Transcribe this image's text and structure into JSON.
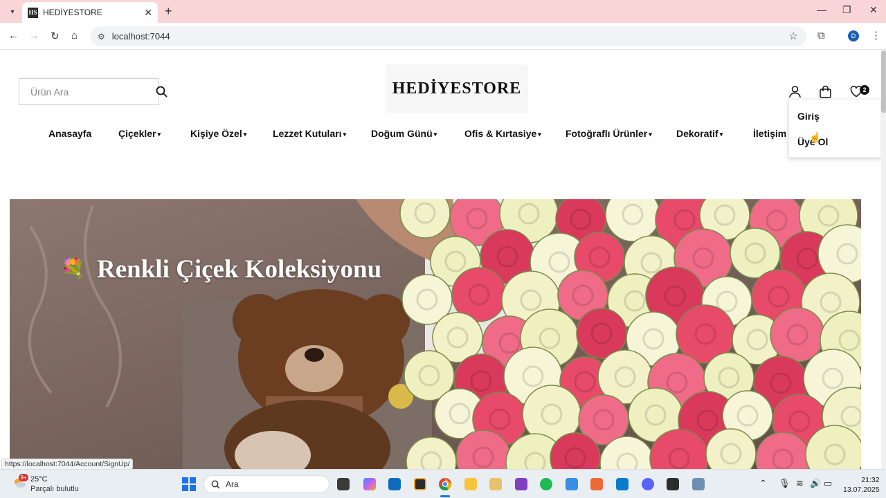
{
  "browser": {
    "tab_title": "HEDİYESTORE",
    "favicon_text": "HS",
    "new_tab": "+",
    "url": "localhost:7044",
    "status_url": "https://localhost:7044/Account/SignUp/",
    "profile_initial": "D"
  },
  "header": {
    "search_placeholder": "Ürün Ara",
    "logo_text": "HEDİYESTORE",
    "favorites_count": "2"
  },
  "nav": {
    "items": [
      {
        "label": "Anasayfa"
      },
      {
        "label": "Çiçekler"
      },
      {
        "label": "Kişiye Özel"
      },
      {
        "label": "Lezzet Kutuları"
      },
      {
        "label": "Doğum Günü"
      },
      {
        "label": "Ofis & Kırtasiye"
      },
      {
        "label": "Fotoğraflı Ürünler"
      },
      {
        "label": "Dekoratif"
      },
      {
        "label": "İletişim"
      }
    ],
    "caret": "▾"
  },
  "account_dropdown": {
    "login": "Giriş",
    "signup": "Üye Ol"
  },
  "banner": {
    "title": "Renkli Çiçek Koleksiyonu",
    "emoji": "💐"
  },
  "taskbar": {
    "weather_badge": "9+",
    "temperature": "25°C",
    "condition": "Parçalı bulutlu",
    "search_label": "Ara",
    "time": "21:32",
    "date": "13.07.2025"
  }
}
